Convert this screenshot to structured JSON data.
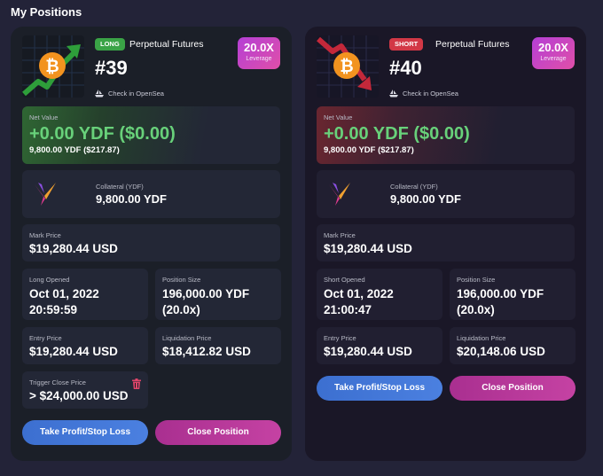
{
  "page": {
    "heading": "My Positions"
  },
  "positions": [
    {
      "type_badge": "LONG",
      "product": "Perpetual Futures",
      "nft_id": "#39",
      "opensea_label": "Check in OpenSea",
      "leverage_value": "20.0X",
      "leverage_label": "Leverage",
      "net_value_label": "Net Value",
      "net_value": "+0.00 YDF ($0.00)",
      "net_value_sub": "9,800.00 YDF ($217.87)",
      "collateral_label": "Collateral (YDF)",
      "collateral_value": "9,800.00 YDF",
      "mark_price_label": "Mark Price",
      "mark_price": "$19,280.44 USD",
      "opened_label": "Long Opened",
      "opened_date": "Oct 01, 2022",
      "opened_time": "20:59:59",
      "size_label": "Position Size",
      "size_value": "196,000.00 YDF",
      "size_leverage": "(20.0x)",
      "entry_label": "Entry Price",
      "entry_price": "$19,280.44 USD",
      "liq_label": "Liquidation Price",
      "liq_price": "$18,412.82 USD",
      "trigger_label": "Trigger Close Price",
      "trigger_value": "> $24,000.00 USD",
      "tp_button": "Take Profit/Stop Loss",
      "close_button": "Close Position"
    },
    {
      "type_badge": "SHORT",
      "product": "Perpetual Futures",
      "nft_id": "#40",
      "opensea_label": "Check in OpenSea",
      "leverage_value": "20.0X",
      "leverage_label": "Leverage",
      "net_value_label": "Net Value",
      "net_value": "+0.00 YDF ($0.00)",
      "net_value_sub": "9,800.00 YDF ($217.87)",
      "collateral_label": "Collateral (YDF)",
      "collateral_value": "9,800.00 YDF",
      "mark_price_label": "Mark Price",
      "mark_price": "$19,280.44 USD",
      "opened_label": "Short Opened",
      "opened_date": "Oct 01, 2022",
      "opened_time": "21:00:47",
      "size_label": "Position Size",
      "size_value": "196,000.00 YDF",
      "size_leverage": "(20.0x)",
      "entry_label": "Entry Price",
      "entry_price": "$19,280.44 USD",
      "liq_label": "Liquidation Price",
      "liq_price": "$20,148.06 USD",
      "tp_button": "Take Profit/Stop Loss",
      "close_button": "Close Position"
    }
  ],
  "colors": {
    "long": "#3aa346",
    "short": "#d23846",
    "profit_green": "#68d17a",
    "leverage_gradient": "#b43fd6",
    "tp_button": "#4b80e0",
    "close_button": "#c542a3"
  },
  "icons": {
    "coin": "bitcoin-coin-icon",
    "opensea": "sailboat-icon",
    "collateral": "ydf-logo-icon",
    "delete": "trash-icon"
  }
}
